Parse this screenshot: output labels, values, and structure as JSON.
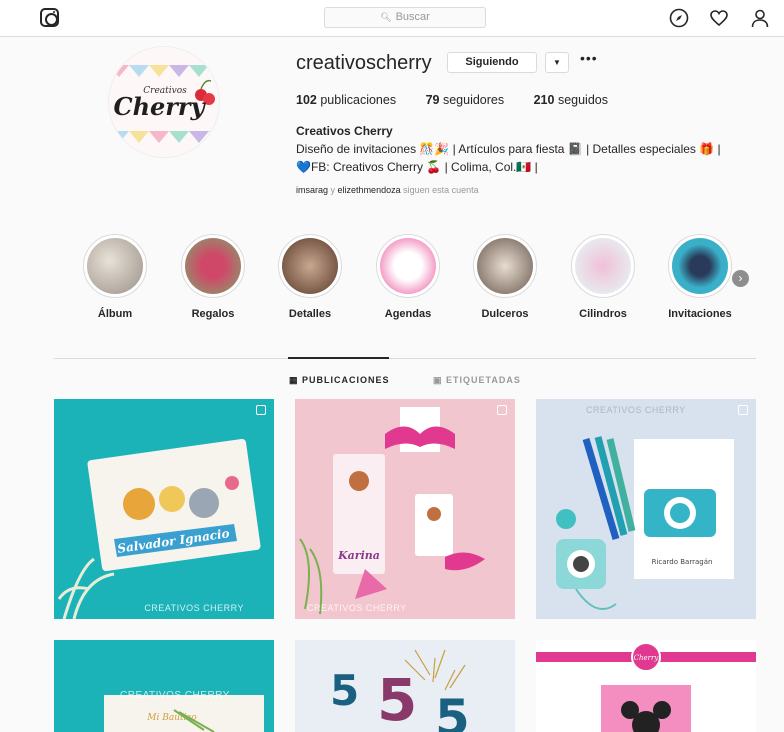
{
  "nav": {
    "search_placeholder": "Buscar",
    "icons": [
      "instagram-icon",
      "compass-icon",
      "heart-icon",
      "profile-icon"
    ]
  },
  "profile": {
    "username": "creativoscherry",
    "follow_label": "Siguiendo",
    "stats": {
      "posts_count": "102",
      "posts_label": "publicaciones",
      "followers_count": "79",
      "followers_label": "seguidores",
      "following_count": "210",
      "following_label": "seguidos"
    },
    "full_name": "Creativos Cherry",
    "bio_line1": "Diseño de invitaciones 🎊🎉 | Artículos para fiesta 📓 | Detalles especiales 🎁 |",
    "bio_line2": "💙FB: Creativos Cherry 🍒 | Colima, Col.🇲🇽 |",
    "followed_by_1": "imsarag",
    "followed_by_sep": "y",
    "followed_by_2": "elizethmendoza",
    "followed_by_suffix": "siguen esta cuenta",
    "avatar_text": "Cherry",
    "avatar_subtext": "Creativos"
  },
  "highlights": [
    {
      "label": "Álbum"
    },
    {
      "label": "Regalos"
    },
    {
      "label": "Detalles"
    },
    {
      "label": "Agendas"
    },
    {
      "label": "Dulceros"
    },
    {
      "label": "Cilindros"
    },
    {
      "label": "Invitaciones"
    }
  ],
  "tabs": {
    "posts": "PUBLICACIONES",
    "tagged": "ETIQUETADAS"
  },
  "posts": {
    "p1_name": "Salvador Ignacio",
    "p2_name": "Karina",
    "p3_name": "Ricardo Barragán",
    "p4_name": "Mi Bautizo",
    "watermark": "CREATIVOS CHERRY",
    "brand_small": "Cherry"
  },
  "colors": {
    "teal": "#1bb3b8",
    "pink": "#f2c6cf",
    "magenta": "#e0398f",
    "lightblue": "#d8e2ee"
  }
}
